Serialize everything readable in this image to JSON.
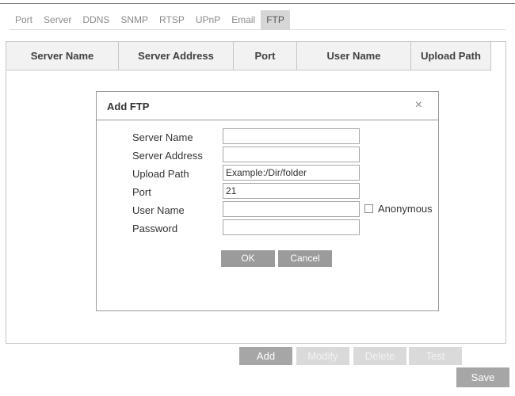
{
  "tabs": [
    {
      "label": "Port",
      "active": false
    },
    {
      "label": "Server",
      "active": false
    },
    {
      "label": "DDNS",
      "active": false
    },
    {
      "label": "SNMP",
      "active": false
    },
    {
      "label": "RTSP",
      "active": false
    },
    {
      "label": "UPnP",
      "active": false
    },
    {
      "label": "Email",
      "active": false
    },
    {
      "label": "FTP",
      "active": true
    }
  ],
  "table": {
    "columns": [
      "Server Name",
      "Server Address",
      "Port",
      "User Name",
      "Upload Path"
    ],
    "rows": []
  },
  "dialog": {
    "title": "Add FTP",
    "close_symbol": "×",
    "fields": {
      "server_name": {
        "label": "Server Name",
        "value": ""
      },
      "server_address": {
        "label": "Server Address",
        "value": ""
      },
      "upload_path": {
        "label": "Upload Path",
        "value": "Example:/Dir/folder"
      },
      "port": {
        "label": "Port",
        "value": "21"
      },
      "user_name": {
        "label": "User Name",
        "value": ""
      },
      "password": {
        "label": "Password",
        "value": ""
      }
    },
    "anonymous": {
      "label": "Anonymous",
      "checked": false
    },
    "ok_label": "OK",
    "cancel_label": "Cancel"
  },
  "actions": {
    "add": "Add",
    "modify": "Modify",
    "delete": "Delete",
    "test": "Test"
  },
  "save_label": "Save",
  "colors": {
    "active_tab": "#d6d6d6",
    "button": "#a6a6a6",
    "button_disabled": "#dadada",
    "border": "#c6c6c6"
  }
}
